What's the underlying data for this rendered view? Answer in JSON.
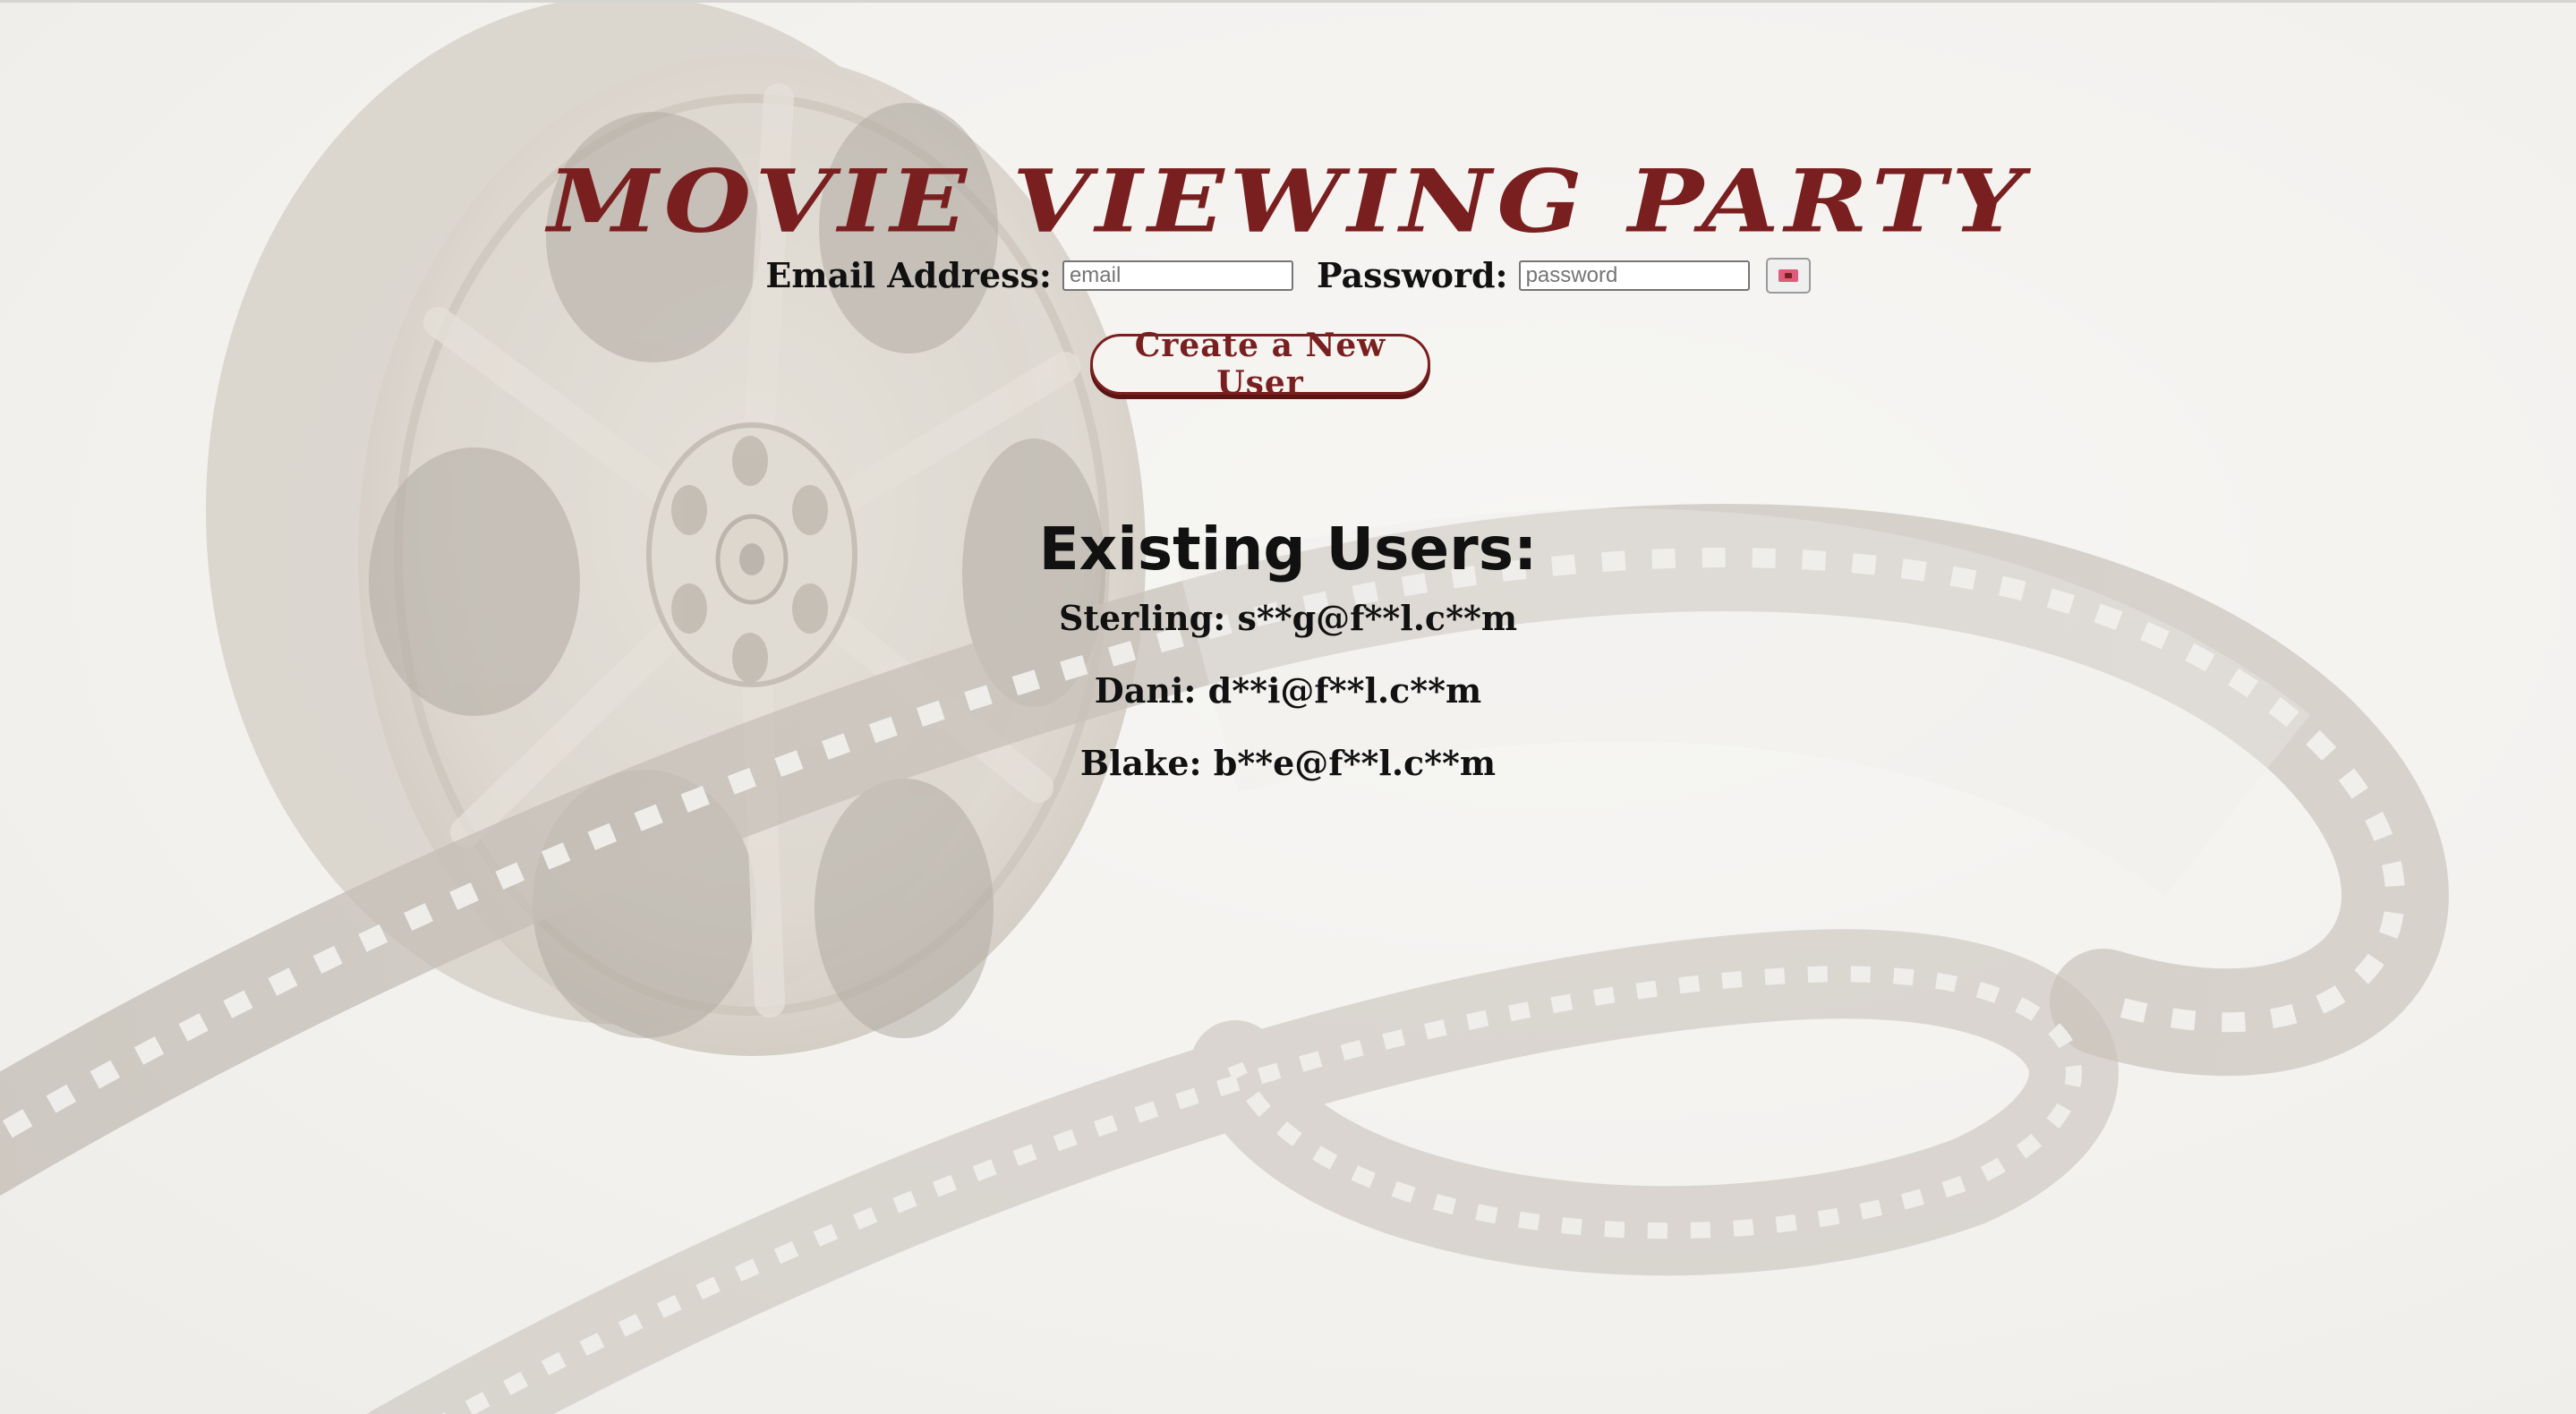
{
  "page": {
    "title": "MOVIE VIEWING PARTY"
  },
  "login": {
    "email_label": "Email Address:",
    "email_placeholder": "email",
    "email_value": "",
    "password_label": "Password:",
    "password_placeholder": "password",
    "password_value": "",
    "submit_icon": "ticket-icon"
  },
  "create_user": {
    "label": "Create a New User"
  },
  "existing_users": {
    "heading": "Existing Users:",
    "users": [
      {
        "name": "Sterling",
        "email": "s**g@f**l.c**m",
        "display": "Sterling: s**g@f**l.c**m"
      },
      {
        "name": "Dani",
        "email": "d**i@f**l.c**m",
        "display": "Dani: d**i@f**l.c**m"
      },
      {
        "name": "Blake",
        "email": "b**e@f**l.c**m",
        "display": "Blake: b**e@f**l.c**m"
      }
    ]
  },
  "colors": {
    "accent": "#7a1f1f",
    "background": "#f3f2f0",
    "text": "#111111",
    "ticket_icon": "#e05a7a"
  },
  "background_image": "film-reel-and-filmstrip-illustration"
}
